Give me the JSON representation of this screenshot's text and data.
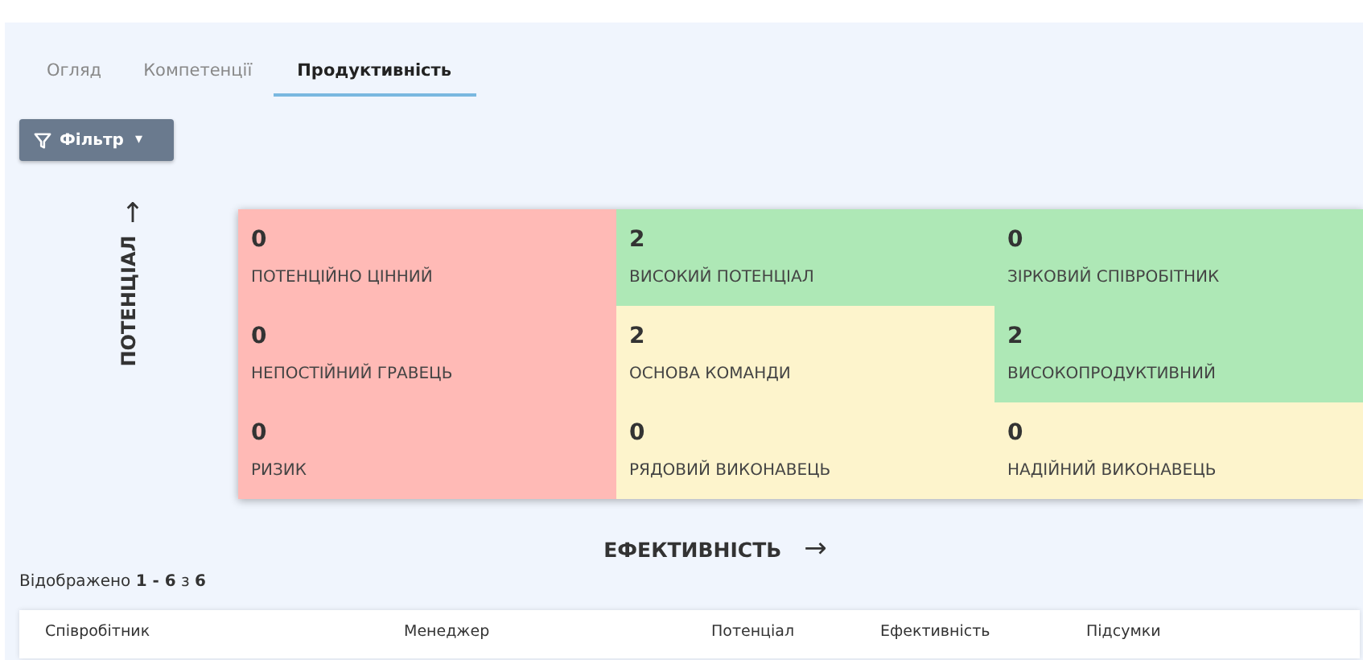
{
  "tabs": [
    {
      "label": "Огляд",
      "selected": false
    },
    {
      "label": "Компетенції",
      "selected": false
    },
    {
      "label": "Продуктивність",
      "selected": true
    }
  ],
  "filter_button": {
    "label": "Фільтр",
    "caret": "▾"
  },
  "matrix": {
    "y_axis": {
      "label": "ПОТЕНЦІАЛ",
      "arrow": "↑"
    },
    "x_axis": {
      "label": "ЕФЕКТИВНІСТЬ",
      "arrow": "→"
    },
    "cells": [
      {
        "count": "0",
        "label": "ПОТЕНЦІЙНО ЦІННИЙ",
        "color": "#ffbab6"
      },
      {
        "count": "2",
        "label": "ВИСОКИЙ ПОТЕНЦІАЛ",
        "color": "#aee8b6"
      },
      {
        "count": "0",
        "label": "ЗІРКОВИЙ СПІВРОБІТНИК",
        "color": "#aee8b6"
      },
      {
        "count": "0",
        "label": "НЕПОСТІЙНИЙ ГРАВЕЦЬ",
        "color": "#ffbab6"
      },
      {
        "count": "2",
        "label": "ОСНОВА КОМАНДИ",
        "color": "#fdf4cc"
      },
      {
        "count": "2",
        "label": "ВИСОКОПРОДУКТИВНИЙ",
        "color": "#aee8b6"
      },
      {
        "count": "0",
        "label": "РИЗИК",
        "color": "#ffbab6"
      },
      {
        "count": "0",
        "label": "РЯДОВИЙ ВИКОНАВЕЦЬ",
        "color": "#fdf4cc"
      },
      {
        "count": "0",
        "label": "НАДІЙНИЙ ВИКОНАВЕЦЬ",
        "color": "#fdf4cc"
      }
    ]
  },
  "results_summary": "Відображено **1 - 6** з **6**",
  "table": {
    "columns": [
      "Співробітник",
      "Менеджер",
      "Потенціал",
      "Ефективність",
      "Підсумки"
    ]
  }
}
